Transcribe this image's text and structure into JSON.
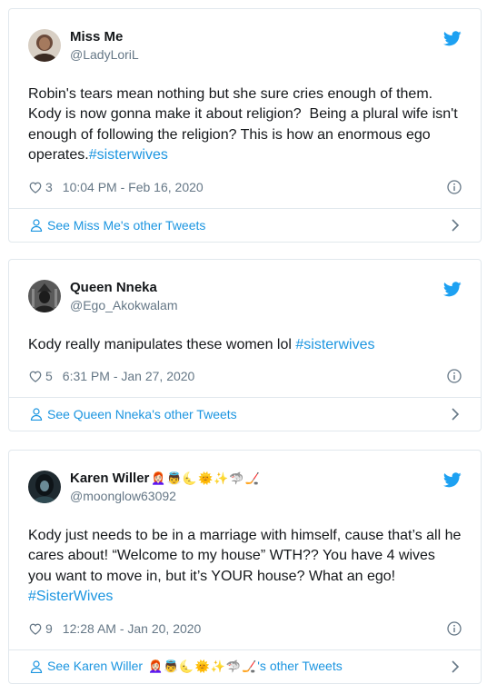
{
  "tweets": [
    {
      "display_name": "Miss Me",
      "handle": "@LadyLoriL",
      "text_parts": [
        "Robin's tears mean nothing but she sure cries enough of them. Kody is now gonna make it about religion?  Being a plural wife isn't enough of following the religion? This is how an enormous ego operates.",
        "#sisterwives"
      ],
      "likes": "3",
      "timestamp": "10:04 PM - Feb 16, 2020",
      "footer": "See Miss Me's other Tweets",
      "avatar_color": "#6b4a3a"
    },
    {
      "display_name": "Queen Nneka",
      "handle": "@Ego_Akokwalam",
      "text_parts": [
        "Kody really manipulates these women lol ",
        "#sisterwives"
      ],
      "likes": "5",
      "timestamp": "6:31 PM - Jan 27, 2020",
      "footer": "See Queen Nneka's other Tweets",
      "avatar_color": "#3b3b3b"
    },
    {
      "display_name": "Karen Willer",
      "name_emojis": "👩🏻‍🦰👼🌜🌞✨🦈🏒",
      "handle": "@moonglow63092",
      "text_parts": [
        "Kody just needs to be in a marriage with himself, cause that’s all he cares about! “Welcome to my house” WTH?? You have 4 wives you want to move in, but it’s YOUR house? What an ego! ",
        "#SisterWives"
      ],
      "likes": "9",
      "timestamp": "12:28 AM - Jan 20, 2020",
      "footer_prefix": "See Karen Willer ",
      "footer_emojis": "👩🏻‍🦰👼🌜🌞✨🦈🏒",
      "footer_suffix": "'s other Tweets",
      "avatar_color": "#2a2a3a"
    }
  ],
  "colors": {
    "accent": "#1b95e0",
    "muted": "#657786",
    "border": "#e1e8ed"
  }
}
